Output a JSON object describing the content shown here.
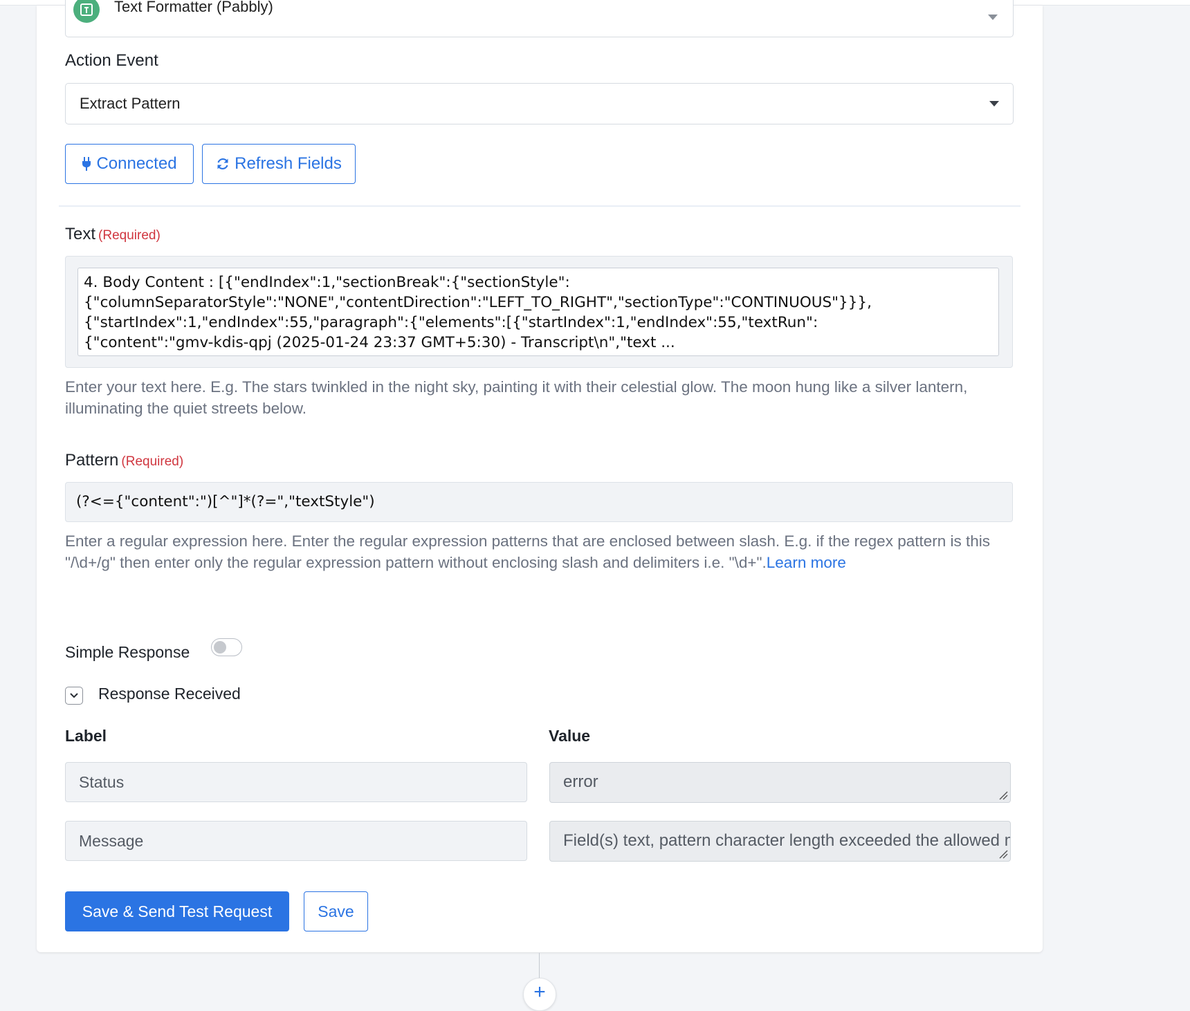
{
  "app_select": {
    "value": "Text Formatter (Pabbly)",
    "icon": "text-formatter-app-icon"
  },
  "action_event": {
    "label": "Action Event",
    "value": "Extract Pattern"
  },
  "buttons": {
    "connected": "Connected",
    "refresh_fields": "Refresh Fields",
    "save_and_send": "Save & Send Test Request",
    "save": "Save"
  },
  "text_field": {
    "label": "Text",
    "required": "(Required)",
    "lines": [
      "4. Body Content : [{\"endIndex\":1,\"sectionBreak\":{\"sectionStyle\":",
      "{\"columnSeparatorStyle\":\"NONE\",\"contentDirection\":\"LEFT_TO_RIGHT\",\"sectionType\":\"CONTINUOUS\"}}},",
      "{\"startIndex\":1,\"endIndex\":55,\"paragraph\":{\"elements\":[{\"startIndex\":1,\"endIndex\":55,\"textRun\":",
      "{\"content\":\"gmv-kdis-qpj (2025-01-24 23:37 GMT+5:30) - Transcript\\n\",\"text ..."
    ],
    "help": "Enter your text here. E.g. The stars twinkled in the night sky, painting it with their celestial glow. The moon hung like a silver lantern, illuminating the quiet streets below."
  },
  "pattern_field": {
    "label": "Pattern",
    "required": "(Required)",
    "value": "(?<={\"content\":\")[^\"]*(?=\",\"textStyle\")",
    "help": "Enter a regular expression here. Enter the regular expression patterns that are enclosed between slash. E.g. if the regex pattern is this \"/\\d+/g\" then enter only the regular expression pattern without enclosing slash and delimiters i.e. \"\\d+\".",
    "learn_more": "Learn more"
  },
  "simple_response": {
    "label": "Simple Response",
    "enabled": false
  },
  "response_received": {
    "label": "Response Received",
    "columns": {
      "label": "Label",
      "value": "Value"
    },
    "rows": [
      {
        "label": "Status",
        "value": "error"
      },
      {
        "label": "Message",
        "value": "Field(s) text, pattern character length exceeded the allowed max value!"
      }
    ]
  },
  "colors": {
    "accent": "#2b74e3",
    "required": "#d0363f",
    "app_icon": "#4caf7d"
  }
}
